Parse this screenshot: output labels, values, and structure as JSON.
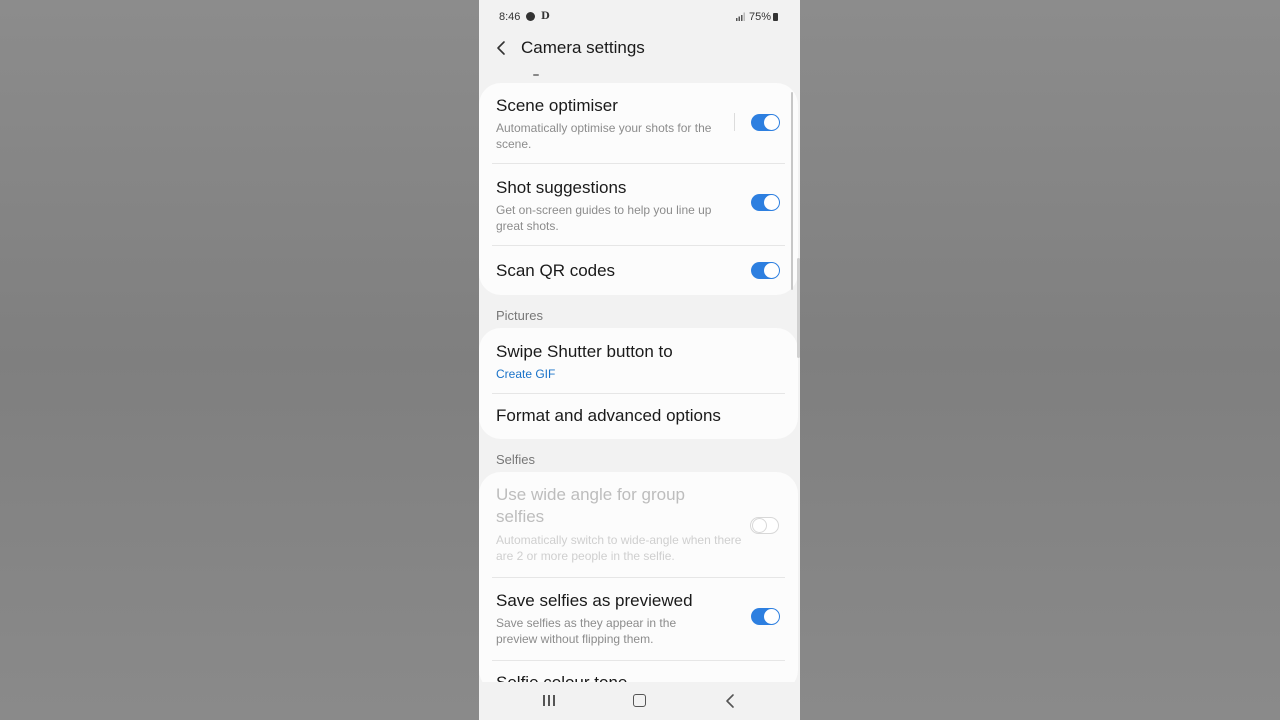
{
  "status_bar": {
    "time": "8:46",
    "d_icon": "D",
    "battery": "75%",
    "icons": [
      "profile-icon",
      "signal-icon",
      "battery-icon"
    ]
  },
  "header": {
    "title": "Camera settings",
    "back_icon": "chevron-left-icon"
  },
  "card1": {
    "items": [
      {
        "title": "Scene optimiser",
        "subtitle": "Automatically optimise your shots for the scene.",
        "toggle": true
      },
      {
        "title": "Shot suggestions",
        "subtitle": "Get on-screen guides to help you line up great shots.",
        "toggle": true
      },
      {
        "title": "Scan QR codes",
        "toggle": true
      }
    ]
  },
  "pictures": {
    "label": "Pictures",
    "items": [
      {
        "title": "Swipe Shutter button to",
        "value": "Create GIF"
      },
      {
        "title": "Format and advanced options"
      }
    ]
  },
  "selfies": {
    "label": "Selfies",
    "items": [
      {
        "title": "Use wide angle for group selfies",
        "subtitle": "Automatically switch to wide-angle when there are 2 or more people in the selfie.",
        "toggle": false,
        "disabled": true
      },
      {
        "title": "Save selfies as previewed",
        "subtitle": "Save selfies as they appear in the preview without flipping them.",
        "toggle": true
      },
      {
        "title": "Selfie colour tone"
      }
    ]
  },
  "colors": {
    "toggle_on": "#2d7fe0",
    "accent_value": "#1a73c9",
    "card_bg": "#fcfcfc",
    "screen_bg": "#f2f2f2"
  },
  "nav_bar": {
    "icons": [
      "recents-icon",
      "home-icon",
      "back-icon"
    ]
  }
}
